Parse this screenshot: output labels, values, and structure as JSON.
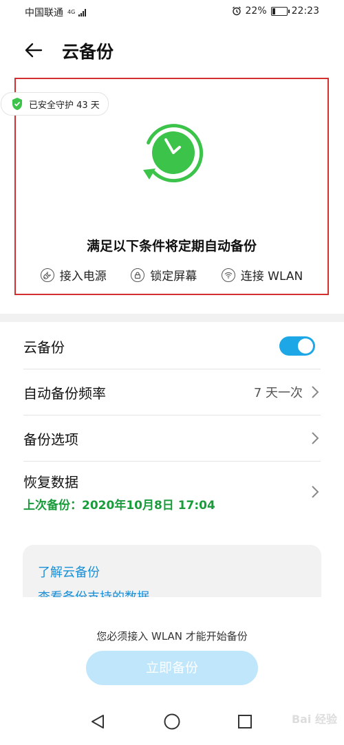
{
  "status_bar": {
    "carrier": "中国联通",
    "network": "4G",
    "battery_percent": "22%",
    "battery_level": 0.22,
    "time": "22:23",
    "icons": [
      "signal-icon",
      "alarm-icon",
      "battery-icon"
    ]
  },
  "app_bar": {
    "back_icon": "back-arrow-icon",
    "title": "云备份"
  },
  "hero": {
    "badge_icon": "shield-check-icon",
    "badge_text": "已安全守护 43 天",
    "graphic_icon": "clock-sync-icon",
    "headline": "满足以下条件将定期自动备份",
    "conditions": [
      {
        "icon": "power-plug-icon",
        "label": "接入电源"
      },
      {
        "icon": "lock-icon",
        "label": "锁定屏幕"
      },
      {
        "icon": "wifi-icon",
        "label": "连接 WLAN"
      }
    ]
  },
  "settings": {
    "cloud_backup": {
      "label": "云备份",
      "enabled": true
    },
    "frequency": {
      "label": "自动备份频率",
      "value": "7 天一次"
    },
    "options": {
      "label": "备份选项"
    },
    "restore": {
      "label": "恢复数据",
      "last_backup": "上次备份：2020年10月8日 17:04"
    }
  },
  "info_card": {
    "learn_link": "了解云备份",
    "supported_data_link": "查看备份支持的数据"
  },
  "footer": {
    "notice": "您必须接入 WLAN 才能开始备份",
    "backup_button": "立即备份"
  },
  "nav_bar": {
    "icons": [
      "back-triangle-icon",
      "home-circle-icon",
      "recents-square-icon"
    ]
  },
  "watermark": "Bai 经验",
  "colors": {
    "accent_green": "#3cc34a",
    "toggle_blue": "#1ea7e6",
    "link_blue": "#1a8fd6",
    "status_green": "#1a9b3c",
    "highlight_red": "#d32f2f",
    "disabled_button": "#bfe6fb"
  }
}
